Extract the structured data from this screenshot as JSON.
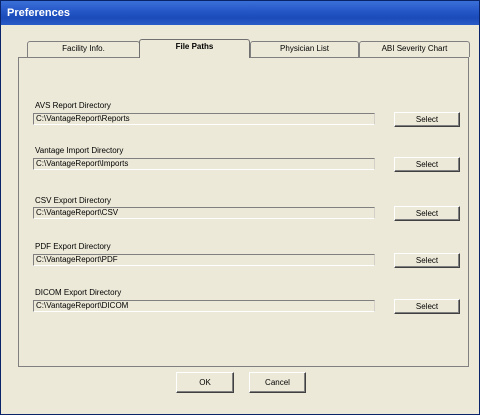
{
  "window": {
    "title": "Preferences"
  },
  "tabs": [
    {
      "label": "Facility Info.",
      "active": false
    },
    {
      "label": "File Paths",
      "active": true
    },
    {
      "label": "Physician List",
      "active": false
    },
    {
      "label": "ABI Severity Chart",
      "active": false
    }
  ],
  "fields": [
    {
      "label": "AVS Report Directory",
      "value": "C:\\VantageReport\\Reports",
      "button": "Select"
    },
    {
      "label": "Vantage Import Directory",
      "value": "C:\\VantageReport\\Imports",
      "button": "Select"
    },
    {
      "label": "CSV Export Directory",
      "value": "C:\\VantageReport\\CSV",
      "button": "Select"
    },
    {
      "label": "PDF Export Directory",
      "value": "C:\\VantageReport\\PDF",
      "button": "Select"
    },
    {
      "label": "DICOM  Export Directory",
      "value": "C:\\VantageReport\\DICOM",
      "button": "Select"
    }
  ],
  "footer": {
    "ok_label": "OK",
    "cancel_label": "Cancel"
  },
  "colors": {
    "title_bar": "#2456c6",
    "dialog_bg": "#ece9d8"
  }
}
